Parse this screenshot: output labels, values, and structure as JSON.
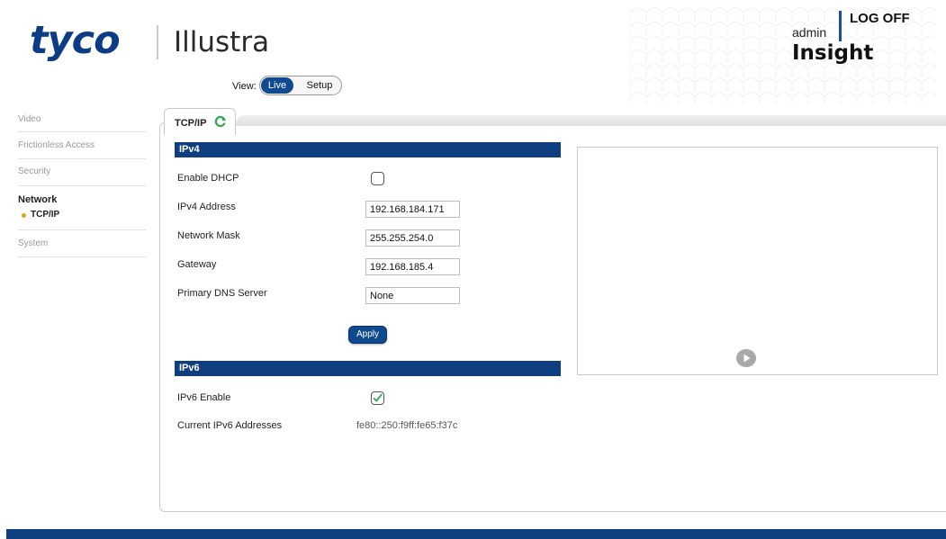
{
  "header": {
    "brand_logo": "tyco",
    "brand_product": "Illustra",
    "user_name": "admin",
    "logoff_label": "LOG OFF",
    "insight_logo": "Insight"
  },
  "view": {
    "label": "View:",
    "live_label": "Live",
    "setup_label": "Setup",
    "active": "Live"
  },
  "sidebar": {
    "items": [
      {
        "label": "Video"
      },
      {
        "label": "Frictionless Access"
      },
      {
        "label": "Security"
      },
      {
        "label": "Network",
        "sub": "TCP/IP"
      },
      {
        "label": "System"
      }
    ]
  },
  "tab": {
    "label": "TCP/IP",
    "icon": "refresh-icon"
  },
  "ipv4": {
    "title": "IPv4",
    "dhcp_label": "Enable DHCP",
    "dhcp_checked": false,
    "address_label": "IPv4 Address",
    "address_value": "192.168.184.171",
    "mask_label": "Network Mask",
    "mask_value": "255.255.254.0",
    "gateway_label": "Gateway",
    "gateway_value": "192.168.185.4",
    "dns_label": "Primary DNS Server",
    "dns_value": "None",
    "apply_label": "Apply"
  },
  "ipv6": {
    "title": "IPv6",
    "enable_label": "IPv6 Enable",
    "enable_checked": true,
    "addresses_label": "Current IPv6 Addresses",
    "addresses_value": "fe80::250:f9ff:fe65:f37c"
  },
  "colors": {
    "brand_blue": "#0c3c86",
    "section_bar": "#0f3f80",
    "button_blue": "#0f4a8f",
    "bullet_orange": "#e4a11b",
    "refresh_green": "#2fa84f"
  },
  "icons": {
    "video_play": "play-icon"
  }
}
